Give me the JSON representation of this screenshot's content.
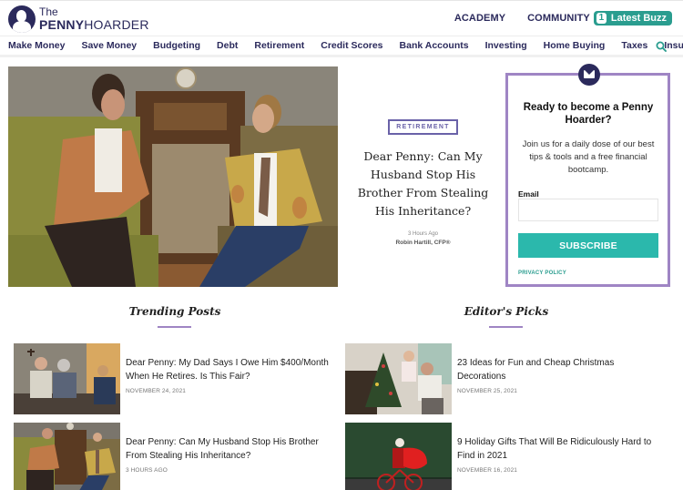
{
  "header": {
    "logo": {
      "the": "The",
      "penny": "PENNY",
      "hoarder": "HOARDER"
    },
    "top_links": [
      {
        "label": "ACADEMY"
      },
      {
        "label": "COMMUNITY"
      }
    ],
    "latest_buzz": {
      "count": "1",
      "label": "Latest Buzz"
    },
    "accent_color": "#2a9d8f",
    "brand_color": "#2b2a5c"
  },
  "nav": {
    "items": [
      {
        "label": "Make Money"
      },
      {
        "label": "Save Money"
      },
      {
        "label": "Budgeting"
      },
      {
        "label": "Debt"
      },
      {
        "label": "Retirement"
      },
      {
        "label": "Credit Scores"
      },
      {
        "label": "Bank Accounts"
      },
      {
        "label": "Investing"
      },
      {
        "label": "Home Buying"
      },
      {
        "label": "Taxes"
      },
      {
        "label": "Insurance"
      }
    ],
    "search_icon": "search-icon"
  },
  "hero": {
    "image": "two-men-talking-on-vintage-sofas",
    "category": "RETIREMENT",
    "title": "Dear Penny: Can My Husband Stop His Brother From Stealing His Inheritance?",
    "time": "3 Hours Ago",
    "author": "Robin Hartill, CFP®"
  },
  "newsletter": {
    "icon": "envelope-icon",
    "title": "Ready to become a Penny Hoarder?",
    "text": "Join us for a daily dose of our best tips & tools and a free financial bootcamp.",
    "email_label": "Email",
    "email_value": "",
    "email_placeholder": "",
    "button_label": "SUBSCRIBE",
    "privacy_label": "PRIVACY POLICY"
  },
  "trending": {
    "heading": "Trending Posts",
    "posts": [
      {
        "image": "elderly-couple-with-woman",
        "title": "Dear Penny: My Dad Says I Owe Him $400/Month When He Retires. Is This Fair?",
        "date": "NOVEMBER 24, 2021"
      },
      {
        "image": "two-men-talking-on-vintage-sofas",
        "title": "Dear Penny: Can My Husband Stop His Brother From Stealing His Inheritance?",
        "date": "3 HOURS AGO"
      }
    ]
  },
  "editors_picks": {
    "heading": "Editor's Picks",
    "posts": [
      {
        "image": "mother-and-child-decorating-christmas-tree",
        "title": "23 Ideas for Fun and Cheap Christmas Decorations",
        "date": "NOVEMBER 25, 2021"
      },
      {
        "image": "santa-riding-bicycle-with-gift-sack",
        "title": "9 Holiday Gifts That Will Be Ridiculously Hard to Find in 2021",
        "date": "NOVEMBER 16, 2021"
      }
    ]
  }
}
